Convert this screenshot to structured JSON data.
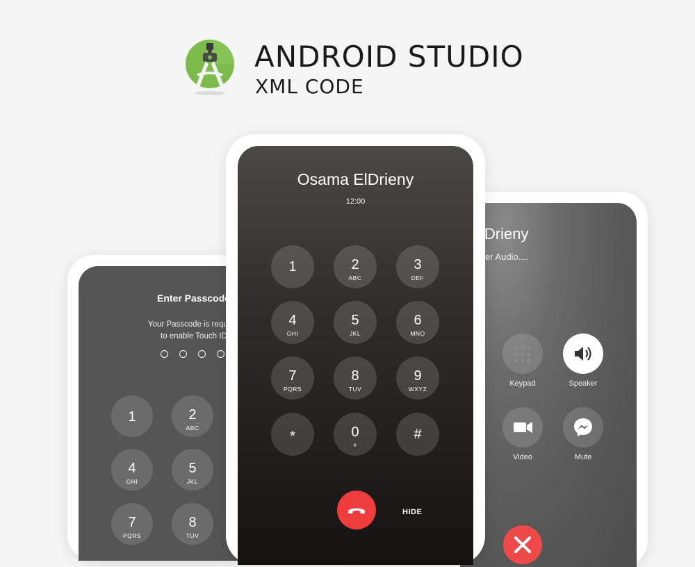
{
  "header": {
    "title": "ANDROID STUDIO",
    "subtitle": "XML CODE",
    "logo_icon": "android-studio-logo-icon"
  },
  "colors": {
    "background": "#f5f5f5",
    "logo_green": "#7cba4c",
    "end_call_red": "#ef3d3d",
    "text_dark": "#1a1a1a"
  },
  "passcode_screen": {
    "title": "Enter Passcode",
    "message_line1": "Your Passcode is requi",
    "message_line2": "to enable Touch ID",
    "keys": [
      {
        "digit": "1",
        "letters": ""
      },
      {
        "digit": "2",
        "letters": "ABC"
      },
      {
        "digit": "4",
        "letters": "GHI"
      },
      {
        "digit": "5",
        "letters": "JKL"
      },
      {
        "digit": "7",
        "letters": "PQRS"
      },
      {
        "digit": "8",
        "letters": "TUV"
      }
    ]
  },
  "dialer_screen": {
    "caller_name": "Osama ElDrieny",
    "time": "12:00",
    "keys": [
      {
        "digit": "1",
        "letters": ""
      },
      {
        "digit": "2",
        "letters": "ABC"
      },
      {
        "digit": "3",
        "letters": "DEF"
      },
      {
        "digit": "4",
        "letters": "GHI"
      },
      {
        "digit": "5",
        "letters": "JKL"
      },
      {
        "digit": "6",
        "letters": "MNO"
      },
      {
        "digit": "7",
        "letters": "PQRS"
      },
      {
        "digit": "8",
        "letters": "TUV"
      },
      {
        "digit": "9",
        "letters": "WXYZ"
      },
      {
        "digit": "*",
        "letters": ""
      },
      {
        "digit": "0",
        "letters": "+"
      },
      {
        "digit": "#",
        "letters": ""
      }
    ],
    "end_call_icon": "phone-hangup-icon",
    "hide_label": "HIDE"
  },
  "incall_screen": {
    "caller_name": "lDrieny",
    "status": "er Audio....",
    "actions": [
      {
        "label": "Keypad",
        "icon": "keypad-icon"
      },
      {
        "label": "Speaker",
        "icon": "speaker-icon"
      },
      {
        "label": "Video",
        "icon": "video-camera-icon"
      },
      {
        "label": "Mute",
        "icon": "messenger-icon"
      }
    ],
    "end_call_icon": "close-icon"
  }
}
